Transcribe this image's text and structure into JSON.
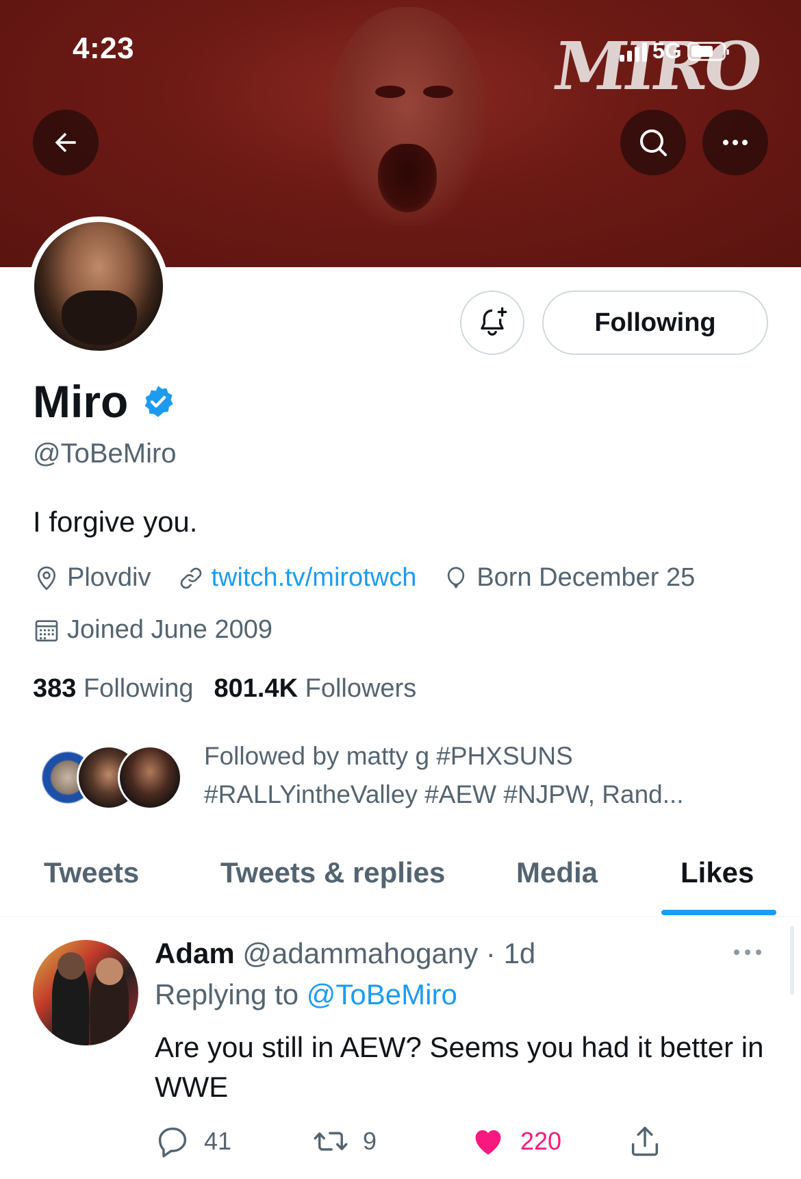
{
  "status_bar": {
    "time": "4:23",
    "network": "5G"
  },
  "banner": {
    "logo_text": "MIRO"
  },
  "profile": {
    "name": "Miro",
    "handle": "@ToBeMiro",
    "bio": "I forgive you.",
    "location": "Plovdiv",
    "website": "twitch.tv/mirotwch",
    "birthday": "Born December 25",
    "joined": "Joined June 2009",
    "following_count": "383",
    "following_label": "Following",
    "followers_count": "801.4K",
    "followers_label": "Followers",
    "followed_by_line1": "Followed by matty g #PHXSUNS",
    "followed_by_line2": "#RALLYintheValley #AEW #NJPW, Rand..."
  },
  "actions": {
    "following_button": "Following"
  },
  "tabs": [
    {
      "label": "Tweets",
      "active": false
    },
    {
      "label": "Tweets & replies",
      "active": false
    },
    {
      "label": "Media",
      "active": false
    },
    {
      "label": "Likes",
      "active": true
    }
  ],
  "tweet": {
    "author": "Adam",
    "handle": "@adammahogany",
    "separator": "·",
    "time": "1d",
    "replying_prefix": "Replying to",
    "replying_to": "@ToBeMiro",
    "text": "Are you still in AEW? Seems you had it better in WWE",
    "replies": "41",
    "retweets": "9",
    "likes": "220"
  },
  "colors": {
    "accent": "#1d9bf0",
    "like": "#f91880",
    "banner": "#6e1a15",
    "verified": "#1d9bf0"
  },
  "icons": [
    "back-arrow-icon",
    "search-icon",
    "more-icon",
    "bell-plus-icon",
    "verified-badge-icon",
    "location-icon",
    "link-icon",
    "balloon-icon",
    "calendar-icon",
    "reply-icon",
    "retweet-icon",
    "heart-icon",
    "share-icon"
  ]
}
